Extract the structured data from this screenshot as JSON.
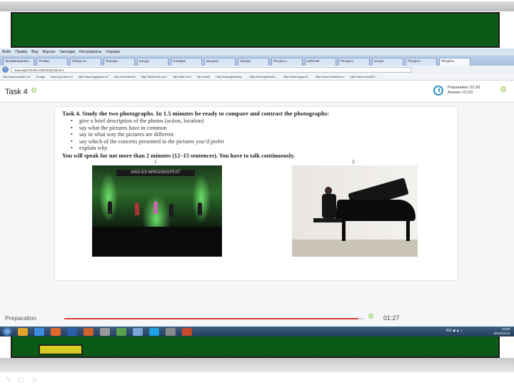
{
  "browser": {
    "menu": [
      "Файл",
      "Правка",
      "Вид",
      "Журнал",
      "Закладки",
      "Инструменты",
      "Справка"
    ],
    "tabs": [
      "Экзаменационн...",
      "Ятники",
      "Обзор по...",
      "Портфо...",
      "ресурс",
      "Словарь",
      "ресурсы",
      "обзоры",
      "Ресурсы...",
      "рабочая",
      "Ресурсы",
      "ресурс",
      "Ресурсы",
      "Ресурсы",
      "Ресурс",
      "Ресурс"
    ],
    "url": "www.egechecks.ru/test/Question/4",
    "bookmarks": [
      "http://www.yandex.ru/",
      "Google",
      "https://yandex.ru/",
      "http://www.egeguide.ru/",
      "http://www.flioca/",
      "http://facebook.com/",
      "http://fast.com/",
      "http://mail/",
      "http://www.globaltop...",
      "http://www.gethwork...",
      "http://www.egeprofi...",
      "http://www.examtest.ru",
      "http://www.mediaPL..."
    ]
  },
  "task": {
    "title": "Task 4",
    "timer_label": "Preparation: 01:30",
    "answer_label": "Answer: 01:53"
  },
  "sheet": {
    "title": "Task 4. Study the two photographs. In 1.5 minutes be ready to compare and contrast the photographs:",
    "bullets": [
      "give a brief description of the photos (action, location)",
      "say what the pictures have in common",
      "say in what way the pictures are different",
      "say which of the concerts presented in the pictures you’d prefer",
      "explain why"
    ],
    "speak": "You will speak for not more than 2 minutes (12–15 sentences). You have to talk continuously.",
    "photo1_number": "1.",
    "photo2_number": "2.",
    "photo1_banner": "ANO-ES BREDONSFEST"
  },
  "footer": {
    "label": "Preparation",
    "time": "01:27",
    "progress_fraction": 0.98
  },
  "taskbar": {
    "clock_time": "19:09",
    "clock_date": "2015/02/13",
    "tray": "RU ◀ ▲ ♪"
  },
  "colors": {
    "green": "#0b5a16",
    "accent_gear": "#8cc63f",
    "progress": "#e23b3b",
    "yellow_button": "#d4cc23"
  }
}
